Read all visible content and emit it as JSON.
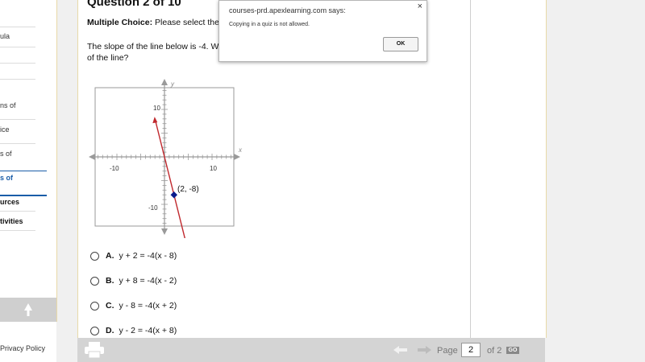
{
  "sidebar": {
    "items": [
      {
        "label": "ula"
      },
      {
        "label": ""
      },
      {
        "label": ""
      },
      {
        "label": "ns of"
      },
      {
        "label": "ice"
      },
      {
        "label": "s of"
      },
      {
        "label": "s of"
      },
      {
        "label": "urces"
      },
      {
        "label": "tivities"
      }
    ],
    "privacy_link": "Privacy Policy"
  },
  "question": {
    "title": "Question 2 of 10",
    "instruction_bold": "Multiple Choice:",
    "instruction_rest": "Please select the",
    "prompt_line1": "The slope of the line below is -4. W",
    "prompt_line2": "of the line?"
  },
  "graph": {
    "x_axis_label": "x",
    "y_axis_label": "y",
    "ticks": {
      "neg_x": "-10",
      "pos_x": "10",
      "pos_y": "10",
      "neg_y": "-10"
    },
    "point_label": "(2, -8)",
    "line_color": "#c0282d",
    "point_color": "#0a1a8c"
  },
  "chart_data": {
    "type": "line",
    "title": "",
    "xlabel": "x",
    "ylabel": "y",
    "xlim": [
      -15,
      15
    ],
    "ylim": [
      -15,
      15
    ],
    "grid": true,
    "series": [
      {
        "slope": -4,
        "x": [
          -3.75,
          3.75
        ],
        "y": [
          7,
          -23
        ]
      }
    ],
    "points": [
      {
        "x": 2,
        "y": -8,
        "label": "(2, -8)"
      }
    ]
  },
  "choices": [
    {
      "letter": "A.",
      "text": "y + 2 = -4(x - 8)"
    },
    {
      "letter": "B.",
      "text": "y + 8 = -4(x - 2)"
    },
    {
      "letter": "C.",
      "text": "y - 8 = -4(x + 2)"
    },
    {
      "letter": "D.",
      "text": "y - 2 = -4(x + 8)"
    }
  ],
  "footer": {
    "page_label": "Page",
    "page_value": "2",
    "page_total": "of 2",
    "go_label": "GO"
  },
  "dialog": {
    "title": "courses-prd.apexlearning.com says:",
    "message": "Copying in a quiz is not allowed.",
    "ok_label": "OK",
    "close_label": "×"
  }
}
